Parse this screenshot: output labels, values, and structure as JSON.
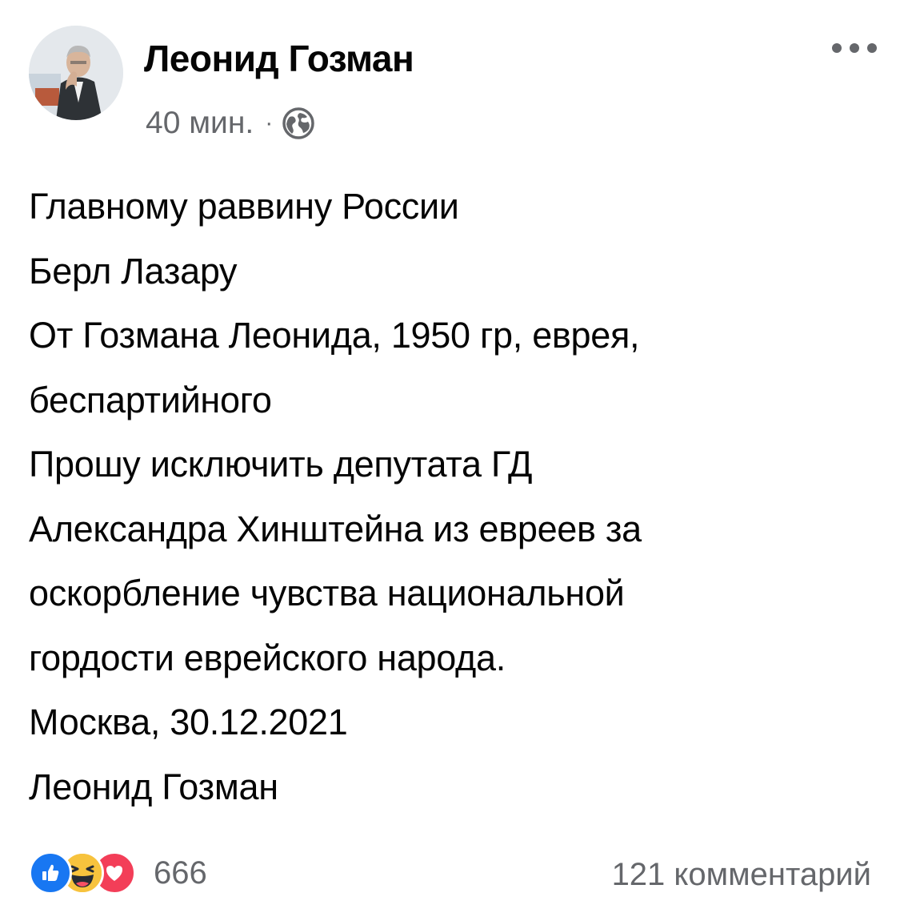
{
  "post": {
    "author": {
      "name": "Леонид Гозман"
    },
    "meta": {
      "time": "40 мин.",
      "separator": "·",
      "privacy_icon": "globe-icon"
    },
    "more_icon": "more-horizontal-icon",
    "body_lines": [
      "Главному раввину России",
      "Берл Лазару",
      "От Гозмана Леонида, 1950 гр, еврея,",
      "беспартийного",
      "Прошу исключить депутата ГД",
      "Александра Хинштейна из евреев за",
      "оскорбление чувства национальной",
      "гордости еврейского народа.",
      "Москва, 30.12.2021",
      "Леонид Гозман"
    ],
    "footer": {
      "reactions": [
        "like-icon",
        "haha-icon",
        "love-icon"
      ],
      "reaction_count": "666",
      "comments": "121 комментарий"
    }
  },
  "colors": {
    "text_primary": "#050505",
    "text_secondary": "#65676b",
    "like_blue": "#1877f2",
    "love_red": "#f33e58",
    "haha_yellow": "#f7b125",
    "background": "#ffffff"
  }
}
